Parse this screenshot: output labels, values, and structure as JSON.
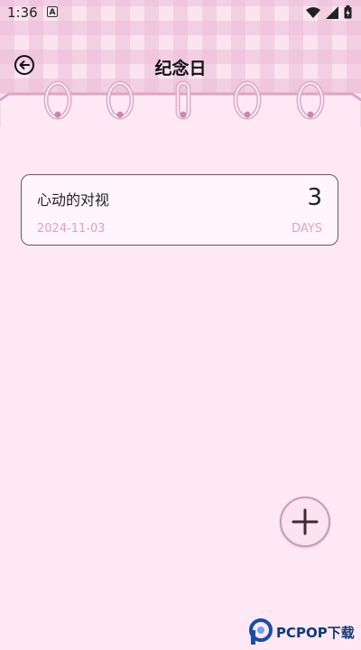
{
  "status_bar": {
    "time": "1:36",
    "notif_letter": "A"
  },
  "header": {
    "title": "纪念日"
  },
  "anniversaries": [
    {
      "name": "心动的对视",
      "count": "3",
      "date": "2024-11-03",
      "unit": "DAYS"
    }
  ],
  "watermark": {
    "text": "PCPOP下载"
  },
  "colors": {
    "accent_pink": "#e0a2c2",
    "ring": "#e8b9d2",
    "card_border": "#6b5a63"
  },
  "icons": {
    "back": "back-arrow-icon",
    "add": "plus-icon"
  }
}
